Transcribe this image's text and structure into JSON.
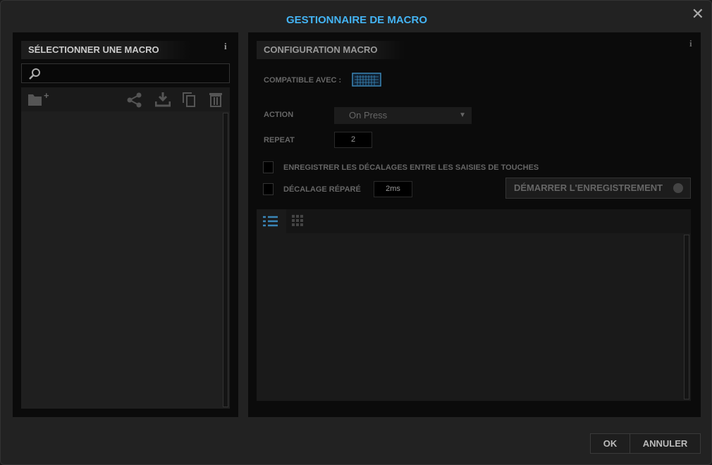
{
  "window": {
    "title": "GESTIONNAIRE DE MACRO",
    "close": "✕"
  },
  "left": {
    "header": "SÉLECTIONNER UNE MACRO",
    "info": "i",
    "search_placeholder": "",
    "search_value": "",
    "toolbar": [
      "new-folder",
      "share",
      "import",
      "duplicate",
      "delete"
    ]
  },
  "right": {
    "header": "CONFIGURATION MACRO",
    "info": "i",
    "compatible_label": "COMPATIBLE AVEC :",
    "compatible_device": "keyboard",
    "action_label": "ACTION",
    "action_value": "On Press",
    "repeat_label": "REPEAT",
    "repeat_value": "2",
    "record_delays_label": "ENREGISTRER LES DÉCALAGES ENTRE LES SAISIES DE TOUCHES",
    "record_delays_checked": false,
    "fixed_delay_label": "DÉCALAGE RÉPARÉ",
    "fixed_delay_checked": false,
    "fixed_delay_value": "2ms",
    "record_button": "DÉMARRER L'ENREGISTREMENT",
    "view_modes": [
      "list",
      "grid"
    ],
    "active_view": "list"
  },
  "footer": {
    "ok": "OK",
    "cancel": "ANNULER"
  },
  "colors": {
    "accent": "#44b4f4",
    "view_active": "#3a86b8"
  }
}
